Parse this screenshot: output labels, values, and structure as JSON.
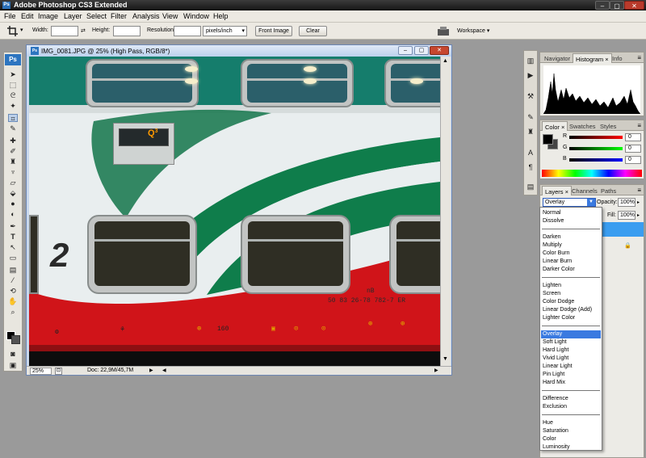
{
  "app": {
    "title": "Adobe Photoshop CS3 Extended",
    "logo": "Ps"
  },
  "menu": [
    "File",
    "Edit",
    "Image",
    "Layer",
    "Select",
    "Filter",
    "Analysis",
    "View",
    "Window",
    "Help"
  ],
  "options": {
    "width_label": "Width:",
    "height_label": "Height:",
    "resolution_label": "Resolution:",
    "resolution_unit": "pixels/inch",
    "front_image_label": "Front Image",
    "clear_label": "Clear",
    "workspace_label": "Workspace"
  },
  "document": {
    "title": "IMG_0081.JPG @ 25% (High Pass, RGB/8*)",
    "icon_label": "Ps",
    "zoom": "25%",
    "doc_info": "Doc: 22,9M/45,7M",
    "photo_text": {
      "big_number": "2",
      "code_line1": "nB",
      "code_line2": "50  83  26-78 782-7  ER",
      "small_number": "160",
      "sign": "3"
    }
  },
  "panels": {
    "nav_tabs": [
      "Navigator",
      "Histogram",
      "Info"
    ],
    "color_tabs": [
      "Color",
      "Swatches",
      "Styles"
    ],
    "color_channels": [
      {
        "label": "R",
        "value": "0"
      },
      {
        "label": "G",
        "value": "0"
      },
      {
        "label": "B",
        "value": "0"
      }
    ],
    "layers_tabs": [
      "Layers",
      "Channels",
      "Paths"
    ],
    "blend_mode": "Overlay",
    "opacity_label": "Opacity:",
    "opacity_value": "100%",
    "fill_label": "Fill:",
    "fill_value": "100%"
  },
  "blend_modes": [
    {
      "label": "Normal"
    },
    {
      "label": "Dissolve"
    },
    {
      "sep": true
    },
    {
      "label": "Darken"
    },
    {
      "label": "Multiply"
    },
    {
      "label": "Color Burn"
    },
    {
      "label": "Linear Burn"
    },
    {
      "label": "Darker Color"
    },
    {
      "sep": true
    },
    {
      "label": "Lighten"
    },
    {
      "label": "Screen"
    },
    {
      "label": "Color Dodge"
    },
    {
      "label": "Linear Dodge (Add)"
    },
    {
      "label": "Lighter Color"
    },
    {
      "sep": true
    },
    {
      "label": "Overlay",
      "selected": true
    },
    {
      "label": "Soft Light"
    },
    {
      "label": "Hard Light"
    },
    {
      "label": "Vivid Light"
    },
    {
      "label": "Linear Light"
    },
    {
      "label": "Pin Light"
    },
    {
      "label": "Hard Mix"
    },
    {
      "sep": true
    },
    {
      "label": "Difference"
    },
    {
      "label": "Exclusion"
    },
    {
      "sep": true
    },
    {
      "label": "Hue"
    },
    {
      "label": "Saturation"
    },
    {
      "label": "Color"
    },
    {
      "label": "Luminosity"
    }
  ],
  "colors": {
    "accent": "#3a7ae0",
    "train_green": "#0e7a4a",
    "train_teal": "#167a6a",
    "train_red": "#d1141c"
  }
}
